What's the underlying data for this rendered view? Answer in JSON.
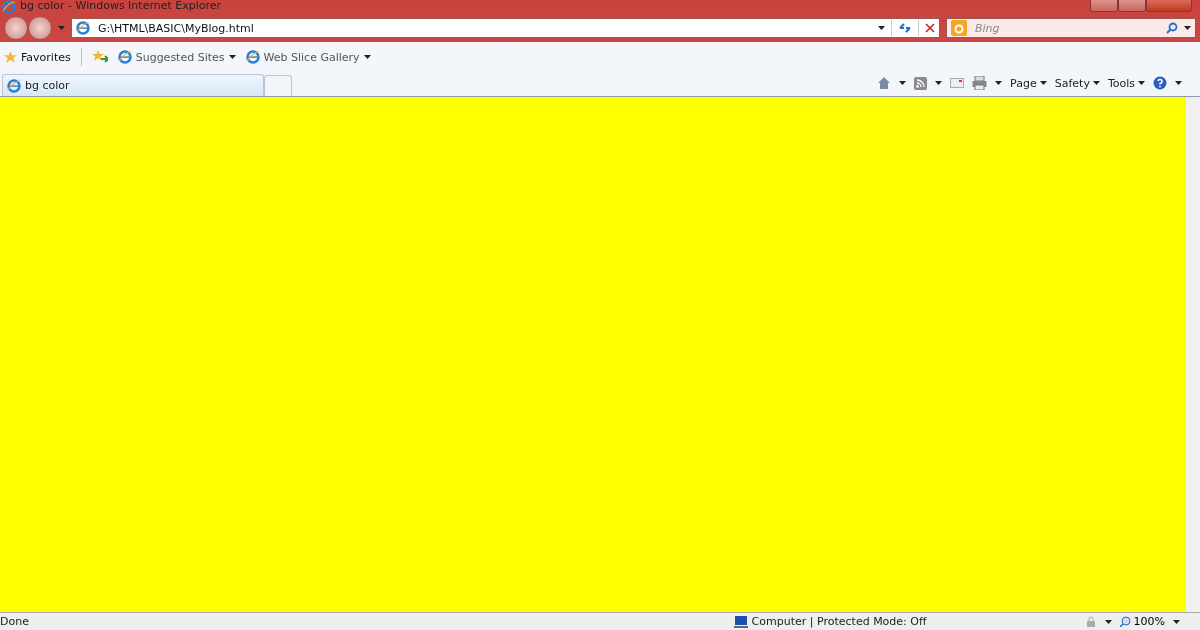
{
  "window": {
    "title": "bg color - Windows Internet Explorer"
  },
  "address_bar": {
    "value": "G:\\HTML\\BASIC\\MyBlog.html"
  },
  "search": {
    "placeholder": "Bing"
  },
  "favorites_bar": {
    "favorites": "Favorites",
    "items": [
      {
        "label": "Suggested Sites"
      },
      {
        "label": "Web Slice Gallery"
      }
    ]
  },
  "tabs": [
    {
      "label": "bg color",
      "selected": true
    }
  ],
  "command_bar": [
    "Page",
    "Safety",
    "Tools"
  ],
  "status_bar": {
    "text": "Done",
    "zone": "Computer | Protected Mode: Off",
    "zoom": "100%"
  }
}
